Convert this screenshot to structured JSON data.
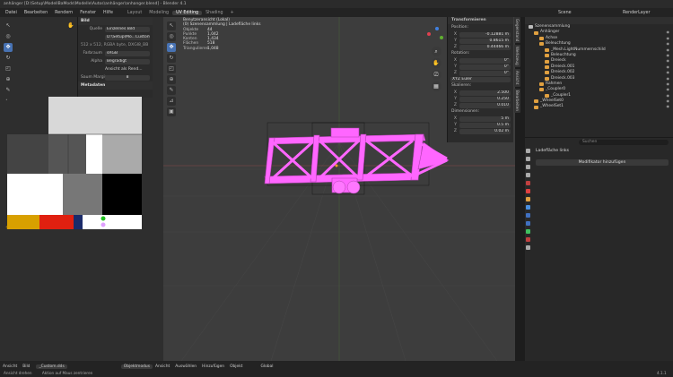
{
  "title_bar": "anhänger [D:\\Setup\\ModellBaMods\\Modelle\\Autos\\anhänger\\anhanger.blend] - Blender 4.1",
  "menus": [
    "Datei",
    "Bearbeiten",
    "Rendern",
    "Fenster",
    "Hilfe"
  ],
  "workspaces": [
    "Layout",
    "Modeling",
    "UV Editing",
    "Shading"
  ],
  "active_workspace": "UV Editing",
  "scene": {
    "scene_label": "Scene",
    "view_layer_label": "RenderLayer"
  },
  "uv_panel": {
    "section_bild": "Bild",
    "quelle_label": "Quelle",
    "quelle_value": "Einzelnes Bild",
    "file_value": "D:\\Setup\\Mo...Custom.dds",
    "info": "512 x 512, RGBA byte, DXGI8_BB",
    "farbraum_label": "Farbraum",
    "farbraum_value": "sRGB",
    "alpha_label": "Alpha",
    "alpha_value": "Begradigt",
    "checkbox_label": "Ansicht als Rend...",
    "seam_label": "Saum Margin",
    "seam_value": "8",
    "section_meta": "Metadaten"
  },
  "viewport_info": {
    "line1": "Benutzeransicht (Lokal)",
    "line2": "(0) Szenensammlung | Ladefläche links",
    "stats": [
      {
        "k": "Objekte",
        "v": "44"
      },
      {
        "k": "Punkte",
        "v": "1,042"
      },
      {
        "k": "Kanten",
        "v": "1,434"
      },
      {
        "k": "Flächen",
        "v": "518"
      },
      {
        "k": "Triangulieren",
        "v": "1,048"
      }
    ]
  },
  "transform": {
    "title": "Transformieren",
    "position_label": "Position:",
    "position": [
      {
        "a": "X",
        "v": "-0.12881 m"
      },
      {
        "a": "Y",
        "v": "0.8615 m"
      },
      {
        "a": "Z",
        "v": "0.44466 m"
      }
    ],
    "rotation_label": "Rotation:",
    "rotation": [
      {
        "a": "X",
        "v": "0°"
      },
      {
        "a": "Y",
        "v": "0°"
      },
      {
        "a": "Z",
        "v": "0°"
      }
    ],
    "mode": "XYZ Euler",
    "scale_label": "Skalieren:",
    "scale": [
      {
        "a": "X",
        "v": "2.500"
      },
      {
        "a": "Y",
        "v": "0.250"
      },
      {
        "a": "Z",
        "v": "0.010"
      }
    ],
    "dims_label": "Dimensionen:",
    "dims": [
      {
        "a": "X",
        "v": "5 m"
      },
      {
        "a": "Y",
        "v": "0.5 m"
      },
      {
        "a": "Z",
        "v": "0.02 m"
      }
    ]
  },
  "side_tabs": [
    "Gegenstand",
    "Werkzeug",
    "Ansicht",
    "Bearbeiten"
  ],
  "outliner": {
    "root": "Szenensammlung",
    "items": [
      {
        "name": "Anhänger",
        "depth": 1,
        "color": "#e0a040"
      },
      {
        "name": "Achse",
        "depth": 2,
        "color": "#e0a040"
      },
      {
        "name": "Beleuchtung",
        "depth": 2,
        "color": "#e0a040"
      },
      {
        "name": "_Mesh.LightNummernschild",
        "depth": 3,
        "color": "#e0a040"
      },
      {
        "name": "Beleuchtung",
        "depth": 3,
        "color": "#e0a040"
      },
      {
        "name": "Dreieck",
        "depth": 3,
        "color": "#e0a040"
      },
      {
        "name": "Dreieck.001",
        "depth": 3,
        "color": "#e0a040"
      },
      {
        "name": "Dreieck.002",
        "depth": 3,
        "color": "#e0a040"
      },
      {
        "name": "Dreieck.003",
        "depth": 3,
        "color": "#e0a040"
      },
      {
        "name": "Rahmen",
        "depth": 2,
        "color": "#e0a040"
      },
      {
        "name": "_Coupler0",
        "depth": 2,
        "color": "#e0a040"
      },
      {
        "name": "_Coupler1",
        "depth": 3,
        "color": "#e0a040"
      },
      {
        "name": "_WheelSet0",
        "depth": 1,
        "color": "#e0a040"
      },
      {
        "name": "_WheelSet1",
        "depth": 1,
        "color": "#e0a040"
      }
    ]
  },
  "properties": {
    "search_placeholder": "Suchen",
    "object_name": "Ladefläche links",
    "add_modifier": "Modifikator hinzufügen"
  },
  "bottom_bar": {
    "uv_items": [
      "Ansicht",
      "Bild",
      "_Custom.dds"
    ],
    "vp_items": [
      "Objektmodus",
      "Ansicht",
      "Auswählen",
      "Hinzufügen",
      "Objekt"
    ],
    "transform_orientation": "Global",
    "status_left": "Ansicht drehen",
    "status_mid": "Aktion auf Maus zentrieren",
    "version": "4.1.1"
  },
  "colors": {
    "mesh": "#ff66ff",
    "accent": "#4772b3",
    "bg": "#3d3d3d"
  }
}
